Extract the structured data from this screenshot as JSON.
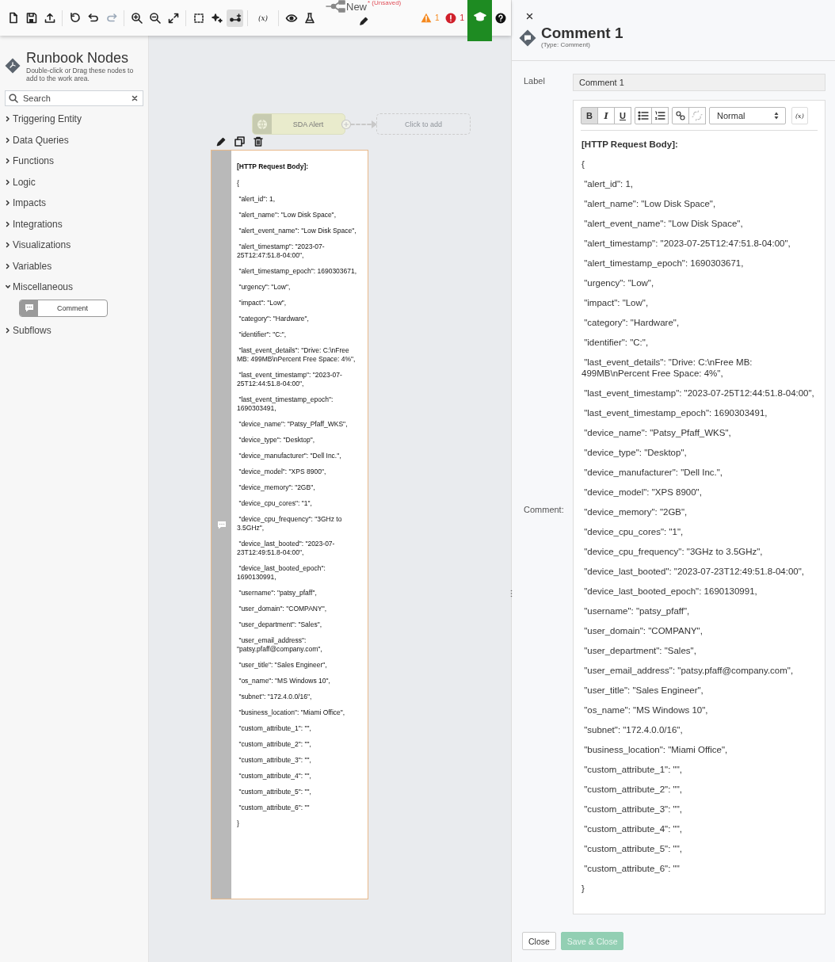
{
  "toolbar": {
    "groups": [
      {
        "buttons": [
          {
            "selected": false,
            "disabled": false
          },
          {
            "selected": false,
            "disabled": false
          },
          {
            "selected": false,
            "disabled": false
          }
        ]
      },
      {
        "buttons": [
          {
            "selected": false,
            "disabled": false
          },
          {
            "selected": false,
            "disabled": false
          },
          {
            "selected": false,
            "disabled": true
          }
        ]
      },
      {
        "buttons": [
          {
            "selected": false,
            "disabled": false
          },
          {
            "selected": false,
            "disabled": false
          },
          {
            "selected": false,
            "disabled": false
          }
        ]
      },
      {
        "buttons": [
          {
            "selected": false,
            "disabled": false
          },
          {
            "selected": false,
            "disabled": false
          },
          {
            "selected": true,
            "disabled": false
          }
        ]
      },
      {
        "buttons": [
          {
            "label": "(x)",
            "selected": false,
            "disabled": false
          }
        ]
      },
      {
        "buttons": [
          {
            "selected": false,
            "disabled": false
          },
          {
            "selected": false,
            "disabled": false
          }
        ]
      }
    ],
    "title": "New",
    "unsaved": "* (Unsaved)",
    "warnings": "1",
    "errors": "1"
  },
  "sidebar": {
    "title": "Runbook Nodes",
    "subtitle": "Double-click or Drag these nodes to add to the work area.",
    "search": {
      "placeholder": "Search"
    },
    "categories": [
      {
        "label": "Triggering Entity",
        "expanded": false
      },
      {
        "label": "Data Queries",
        "expanded": false
      },
      {
        "label": "Functions",
        "expanded": false
      },
      {
        "label": "Logic",
        "expanded": false
      },
      {
        "label": "Impacts",
        "expanded": false
      },
      {
        "label": "Integrations",
        "expanded": false
      },
      {
        "label": "Visualizations",
        "expanded": false
      },
      {
        "label": "Variables",
        "expanded": false
      },
      {
        "label": "Miscellaneous",
        "expanded": true,
        "children": [
          {
            "label": "Comment"
          }
        ]
      },
      {
        "label": "Subflows",
        "expanded": false
      }
    ]
  },
  "canvas": {
    "trigger_node": {
      "label": "SDA Alert"
    },
    "add_node": {
      "label": "Click to add"
    },
    "comment_node": {
      "selected": true,
      "heading": "[HTTP Request Body]:",
      "lines": [
        "{",
        " \"alert_id\": 1,",
        " \"alert_name\": \"Low Disk Space\",",
        " \"alert_event_name\": \"Low Disk Space\",",
        " \"alert_timestamp\": \"2023-07-25T12:47:51.8-04:00\",",
        " \"alert_timestamp_epoch\": 1690303671,",
        " \"urgency\": \"Low\",",
        " \"impact\": \"Low\",",
        " \"category\": \"Hardware\",",
        " \"identifier\": \"C:\",",
        " \"last_event_details\": \"Drive: C:\\nFree MB: 499MB\\nPercent Free Space: 4%\",",
        " \"last_event_timestamp\": \"2023-07-25T12:44:51.8-04:00\",",
        " \"last_event_timestamp_epoch\": 1690303491,",
        " \"device_name\": \"Patsy_Pfaff_WKS\",",
        " \"device_type\": \"Desktop\",",
        " \"device_manufacturer\": \"Dell Inc.\",",
        " \"device_model\": \"XPS 8900\",",
        " \"device_memory\": \"2GB\",",
        " \"device_cpu_cores\": \"1\",",
        " \"device_cpu_frequency\": \"3GHz to 3.5GHz\",",
        " \"device_last_booted\": \"2023-07-23T12:49:51.8-04:00\",",
        " \"device_last_booted_epoch\": 1690130991,",
        " \"username\": \"patsy_pfaff\",",
        " \"user_domain\": \"COMPANY\",",
        " \"user_department\": \"Sales\",",
        " \"user_email_address\": \"patsy.pfaff@company.com\",",
        " \"user_title\": \"Sales Engineer\",",
        " \"os_name\": \"MS Windows 10\",",
        " \"subnet\": \"172.4.0.0/16\",",
        " \"business_location\": \"Miami Office\",",
        " \"custom_attribute_1\": \"\",",
        " \"custom_attribute_2\": \"\",",
        " \"custom_attribute_3\": \"\",",
        " \"custom_attribute_4\": \"\",",
        " \"custom_attribute_5\": \"\",",
        " \"custom_attribute_6\": \"\"",
        "}"
      ]
    }
  },
  "panel": {
    "title": "Comment 1",
    "subtitle": "(Type: Comment)",
    "label_field": {
      "label": "Label",
      "value": "Comment 1"
    },
    "comment_field": {
      "label": "Comment:",
      "format_buttons": [
        {
          "label": "B",
          "active": true
        },
        {
          "label": "I",
          "active": false
        },
        {
          "label": "U",
          "active": false
        }
      ],
      "list_buttons": [
        {
          "active": false
        },
        {
          "active": false
        }
      ],
      "link_buttons": [
        {
          "disabled": false
        },
        {
          "disabled": true
        }
      ],
      "style_select": "Normal",
      "variable_button": "(x)",
      "heading": "[HTTP Request Body]:",
      "lines": [
        "{",
        " \"alert_id\": 1,",
        " \"alert_name\": \"Low Disk Space\",",
        " \"alert_event_name\": \"Low Disk Space\",",
        " \"alert_timestamp\": \"2023-07-25T12:47:51.8-04:00\",",
        " \"alert_timestamp_epoch\": 1690303671,",
        " \"urgency\": \"Low\",",
        " \"impact\": \"Low\",",
        " \"category\": \"Hardware\",",
        " \"identifier\": \"C:\",",
        " \"last_event_details\": \"Drive: C:\\nFree MB: 499MB\\nPercent Free Space: 4%\",",
        " \"last_event_timestamp\": \"2023-07-25T12:44:51.8-04:00\",",
        " \"last_event_timestamp_epoch\": 1690303491,",
        " \"device_name\": \"Patsy_Pfaff_WKS\",",
        " \"device_type\": \"Desktop\",",
        " \"device_manufacturer\": \"Dell Inc.\",",
        " \"device_model\": \"XPS 8900\",",
        " \"device_memory\": \"2GB\",",
        " \"device_cpu_cores\": \"1\",",
        " \"device_cpu_frequency\": \"3GHz to 3.5GHz\",",
        " \"device_last_booted\": \"2023-07-23T12:49:51.8-04:00\",",
        " \"device_last_booted_epoch\": 1690130991,",
        " \"username\": \"patsy_pfaff\",",
        " \"user_domain\": \"COMPANY\",",
        " \"user_department\": \"Sales\",",
        " \"user_email_address\": \"patsy.pfaff@company.com\",",
        " \"user_title\": \"Sales Engineer\",",
        " \"os_name\": \"MS Windows 10\",",
        " \"subnet\": \"172.4.0.0/16\",",
        " \"business_location\": \"Miami Office\",",
        " \"custom_attribute_1\": \"\",",
        " \"custom_attribute_2\": \"\",",
        " \"custom_attribute_3\": \"\",",
        " \"custom_attribute_4\": \"\",",
        " \"custom_attribute_5\": \"\",",
        " \"custom_attribute_6\": \"\"",
        "}"
      ]
    },
    "buttons": [
      {
        "label": "Close",
        "kind": "secondary",
        "disabled": false
      },
      {
        "label": "Save & Close",
        "kind": "primary",
        "disabled": true
      }
    ]
  }
}
